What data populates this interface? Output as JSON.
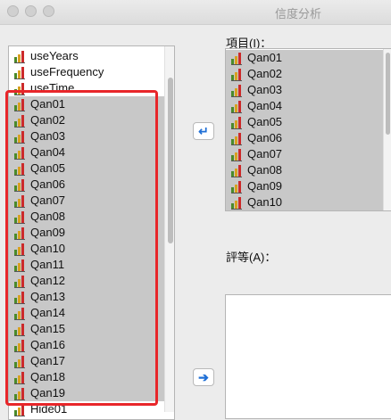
{
  "window": {
    "title": "信度分析"
  },
  "source_list": {
    "items": [
      {
        "label": "useYears",
        "selected": false
      },
      {
        "label": "useFrequency",
        "selected": false
      },
      {
        "label": "useTime",
        "selected": false
      },
      {
        "label": "Qan01",
        "selected": true
      },
      {
        "label": "Qan02",
        "selected": true
      },
      {
        "label": "Qan03",
        "selected": true
      },
      {
        "label": "Qan04",
        "selected": true
      },
      {
        "label": "Qan05",
        "selected": true
      },
      {
        "label": "Qan06",
        "selected": true
      },
      {
        "label": "Qan07",
        "selected": true
      },
      {
        "label": "Qan08",
        "selected": true
      },
      {
        "label": "Qan09",
        "selected": true
      },
      {
        "label": "Qan10",
        "selected": true
      },
      {
        "label": "Qan11",
        "selected": true
      },
      {
        "label": "Qan12",
        "selected": true
      },
      {
        "label": "Qan13",
        "selected": true
      },
      {
        "label": "Qan14",
        "selected": true
      },
      {
        "label": "Qan15",
        "selected": true
      },
      {
        "label": "Qan16",
        "selected": true
      },
      {
        "label": "Qan17",
        "selected": true
      },
      {
        "label": "Qan18",
        "selected": true
      },
      {
        "label": "Qan19",
        "selected": true
      },
      {
        "label": "Hide01",
        "selected": false
      }
    ]
  },
  "items_panel": {
    "label": "項目(I)：",
    "items": [
      "Qan01",
      "Qan02",
      "Qan03",
      "Qan04",
      "Qan05",
      "Qan06",
      "Qan07",
      "Qan08",
      "Qan09",
      "Qan10"
    ]
  },
  "rating_panel": {
    "label": "評等(A)："
  },
  "colors": {
    "highlight_border": "#e8262a",
    "selection": "#c8c8c8",
    "arrow": "#1f6fd6"
  },
  "icons": {
    "variable": "scale-variable-icon",
    "move_in": "arrow-left-icon",
    "move_out": "arrow-right-icon"
  }
}
